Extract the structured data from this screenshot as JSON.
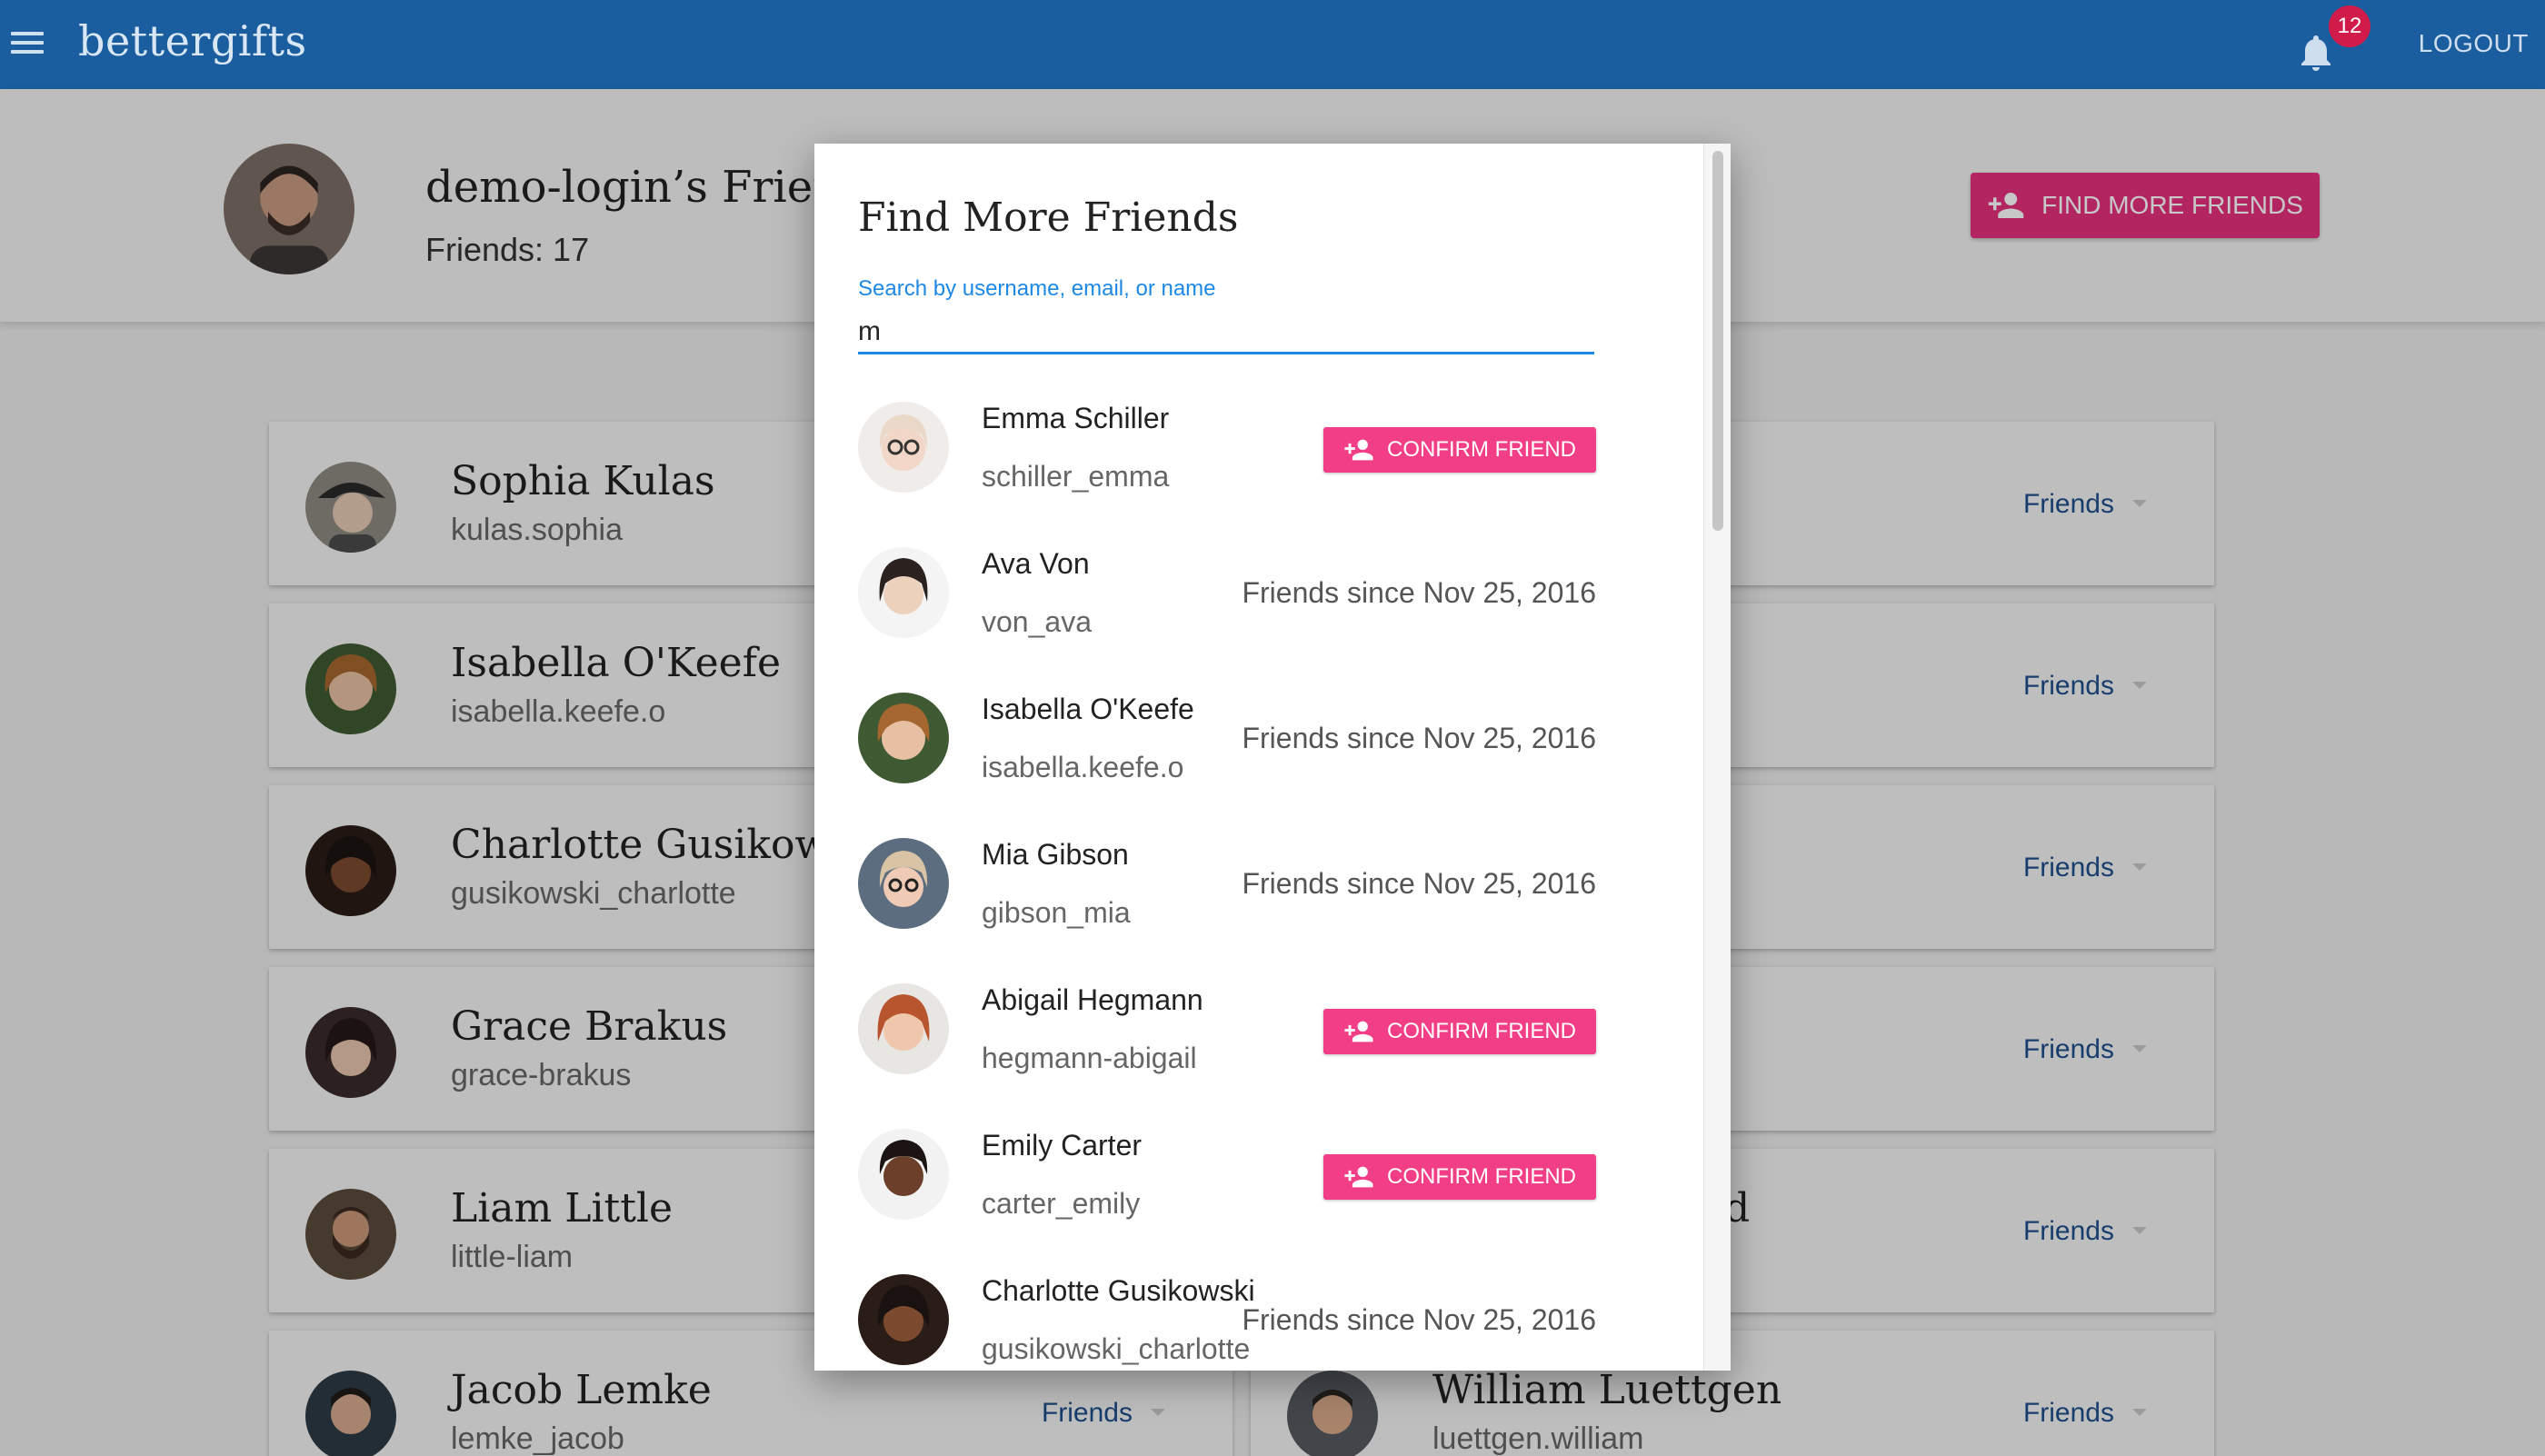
{
  "appbar": {
    "brand": "bettergifts",
    "notification_count": "12",
    "logout_label": "LOGOUT"
  },
  "profile": {
    "title": "demo-login’s Frien",
    "friends_count": "Friends: 17",
    "find_button_label": "FIND MORE FRIENDS"
  },
  "friends_left": [
    {
      "name": "Sophia Kulas",
      "username": "kulas.sophia"
    },
    {
      "name": "Isabella O'Keefe",
      "username": "isabella.keefe.o"
    },
    {
      "name": "Charlotte Gusikows",
      "username": "gusikowski_charlotte"
    },
    {
      "name": "Grace Brakus",
      "username": "grace-brakus"
    },
    {
      "name": "Liam Little",
      "username": "little-liam"
    },
    {
      "name": "Jacob Lemke",
      "username": "lemke_jacob",
      "status": "Friends"
    }
  ],
  "friends_right": [
    {
      "name": "",
      "username": "",
      "status": "Friends"
    },
    {
      "name": "",
      "username": "",
      "status": "Friends"
    },
    {
      "name": "",
      "username": "",
      "status": "Friends"
    },
    {
      "name": "",
      "username": "",
      "status": "Friends"
    },
    {
      "name": "rd",
      "username": "",
      "status": "Friends"
    },
    {
      "name": "William Luettgen",
      "username": "luettgen.william",
      "status": "Friends"
    }
  ],
  "dialog": {
    "title": "Find More Friends",
    "search_label": "Search by username, email, or name",
    "search_value": "m",
    "confirm_label": "CONFIRM FRIEND",
    "results": [
      {
        "name": "Emma Schiller",
        "username": "schiller_emma",
        "since": ""
      },
      {
        "name": "Ava Von",
        "username": "von_ava",
        "since": "Friends since Nov 25, 2016"
      },
      {
        "name": "Isabella O'Keefe",
        "username": "isabella.keefe.o",
        "since": "Friends since Nov 25, 2016"
      },
      {
        "name": "Mia Gibson",
        "username": "gibson_mia",
        "since": "Friends since Nov 25, 2016"
      },
      {
        "name": "Abigail Hegmann",
        "username": "hegmann-abigail",
        "since": ""
      },
      {
        "name": "Emily Carter",
        "username": "carter_emily",
        "since": ""
      },
      {
        "name": "Charlotte Gusikowski",
        "username": "gusikowski_charlotte",
        "since": "Friends since Nov 25, 2016"
      }
    ]
  },
  "colors": {
    "appbar": "#1a5e9f",
    "accent_pink": "#e6307c",
    "confirm_pink": "#f23e86",
    "link_blue": "#1e88e5"
  },
  "icons": {
    "menu": "hamburger-menu-icon",
    "bell": "notification-bell-icon",
    "add_person": "person-add-icon",
    "caret": "caret-down-icon"
  }
}
